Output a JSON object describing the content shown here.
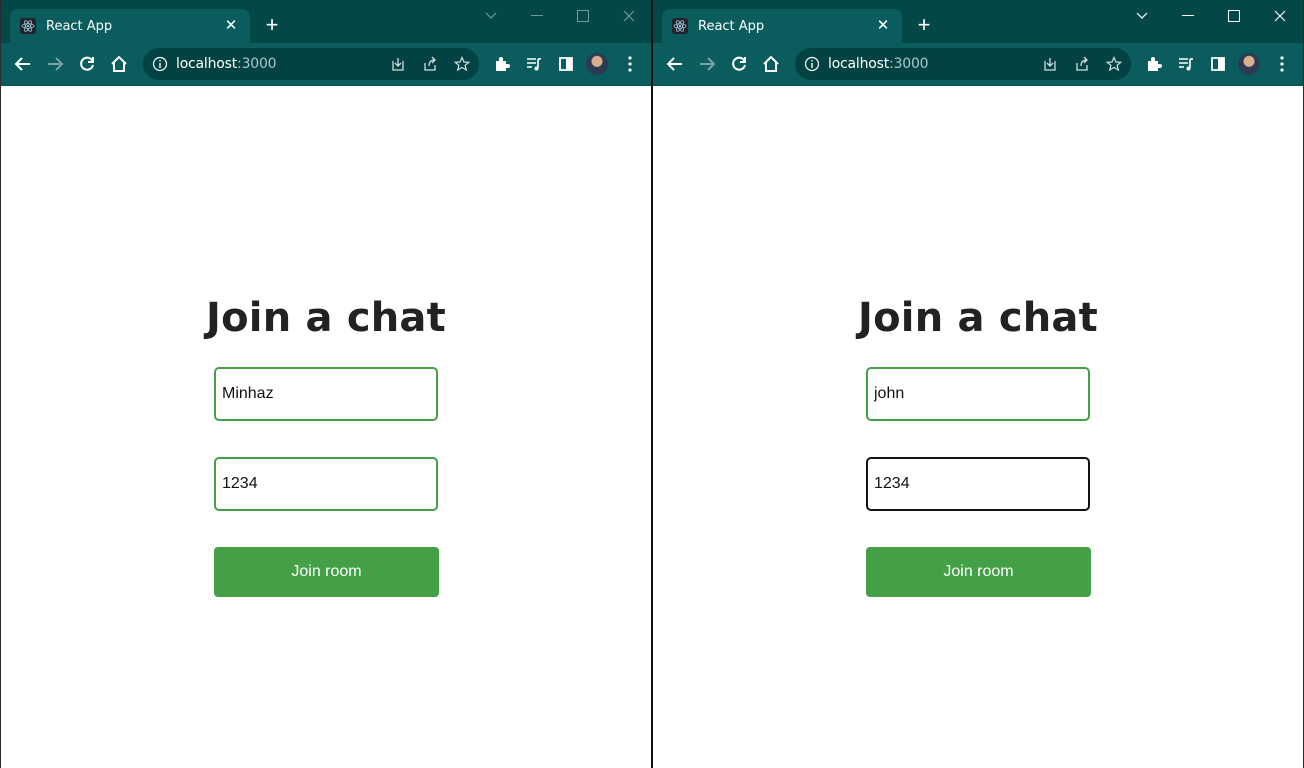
{
  "windows": [
    {
      "tab_title": "React App",
      "url_host": "localhost",
      "url_port": ":3000",
      "heading": "Join a chat",
      "username_value": "Minhaz",
      "room_value": "1234",
      "join_label": "Join room"
    },
    {
      "tab_title": "React App",
      "url_host": "localhost",
      "url_port": ":3000",
      "heading": "Join a chat",
      "username_value": "john",
      "room_value": "1234",
      "join_label": "Join room"
    }
  ],
  "colors": {
    "tabstrip": "#034747",
    "toolbar": "#0b5c5c",
    "accent_green": "#43a047",
    "heading_text": "#222222"
  },
  "icons": [
    "react-favicon-icon",
    "close-icon",
    "plus-icon",
    "chevron-down-icon",
    "minimize-icon",
    "maximize-icon",
    "window-close-icon",
    "back-arrow-icon",
    "forward-arrow-icon",
    "reload-icon",
    "home-icon",
    "info-icon",
    "install-icon",
    "share-icon",
    "star-icon",
    "extensions-icon",
    "media-icon",
    "side-panel-icon",
    "kebab-menu-icon"
  ]
}
